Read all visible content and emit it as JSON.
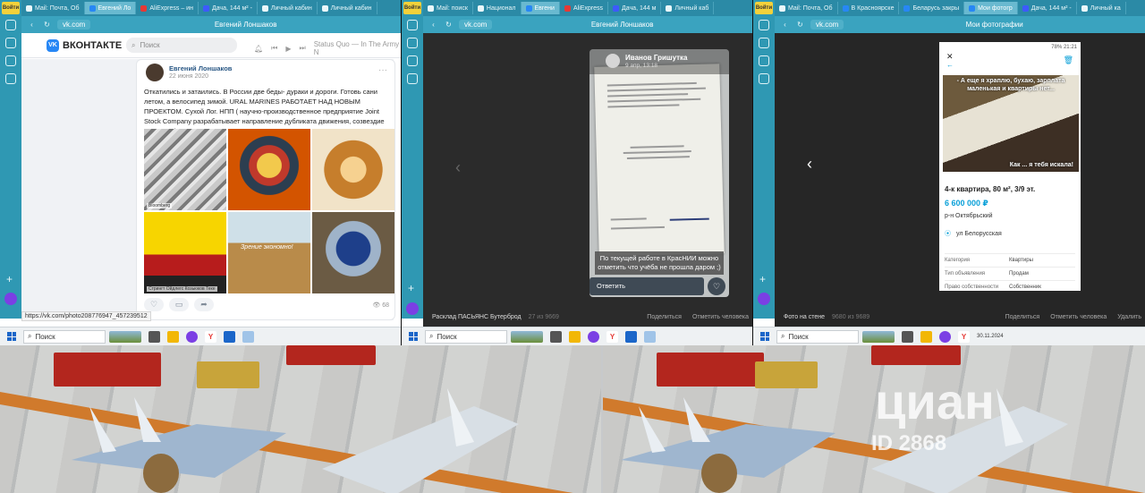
{
  "panel1": {
    "sidebar": {
      "badge": "Войти"
    },
    "tabs": [
      {
        "label": "Mail: Почта, Об",
        "active": false,
        "icon": "mail-icon"
      },
      {
        "label": "Евгений Ло",
        "active": true,
        "icon": "vk-icon"
      },
      {
        "label": "AliExpress – ин",
        "active": false,
        "icon": "aliexpress-icon"
      },
      {
        "label": "Дача, 144 м² -",
        "active": false,
        "icon": "domclick-icon"
      },
      {
        "label": "Личный кабин",
        "active": false,
        "icon": "cabinet-icon"
      },
      {
        "label": "Личный кабин",
        "active": false,
        "icon": "cabinet-icon"
      }
    ],
    "address": {
      "url": "vk.com",
      "title": "Евгений Лоншаков"
    },
    "vk": {
      "logo": "ВКОНТАКТЕ",
      "search_placeholder": "Поиск",
      "track": "Status Quo — In The Army N"
    },
    "post": {
      "author": "Евгений Лоншаков",
      "date": "22 июня 2020",
      "text": "Откатились и затаились. В России две беды- дураки и дороги. Готовь сани летом, а велосипед зимой. URAL MARINES РАБОТАЕТ НАД НОВЫМ ПРОЕКТОМ. Сухой Лог. НПП ( научно-производственное предприятие Joint Stock Company разрабатывает направление дубликата движения, созвездие Водолеев)",
      "captions": {
        "c1": "Bloomberg",
        "c4": "Стрингт Ойдлегс Козьюков Теке",
        "c5": "Зрение экономно!"
      },
      "views": "68"
    },
    "status_url": "https://vk.com/photo208776947_457239512",
    "taskbar": {
      "search": "Поиск"
    }
  },
  "panel2": {
    "tabs": [
      {
        "label": "Mail: поиск",
        "active": false,
        "icon": "mail-icon"
      },
      {
        "label": "Национал",
        "active": false,
        "icon": "news-icon"
      },
      {
        "label": "Евгени",
        "active": true,
        "icon": "vk-icon"
      },
      {
        "label": "AliExpress",
        "active": false,
        "icon": "aliexpress-icon"
      },
      {
        "label": "Дача, 144 м",
        "active": false,
        "icon": "domclick-icon"
      },
      {
        "label": "Личный каб",
        "active": false,
        "icon": "cabinet-icon"
      }
    ],
    "address": {
      "url": "vk.com",
      "title": "Евгений Лоншаков"
    },
    "viewer": {
      "name": "Иванов Гришутка",
      "date": "9 апр, 13:18",
      "caption": "По текущей работе в КрасНИИ можно отметить что учёба не прошла даром ;)",
      "reply": "Ответить"
    },
    "bottom": {
      "album": "Расклад ПАСЬЯНС Бутерброд",
      "counter": "27 из 9669",
      "share": "Поделиться",
      "mark": "Отметить человека"
    },
    "taskbar": {
      "search": "Поиск"
    }
  },
  "panel3": {
    "tabs": [
      {
        "label": "Mail: Почта, Об",
        "active": false,
        "icon": "mail-icon"
      },
      {
        "label": "В Красноярске",
        "active": false,
        "icon": "vk-icon"
      },
      {
        "label": "Беларусь закры",
        "active": false,
        "icon": "vk-icon"
      },
      {
        "label": "Мои фотогр",
        "active": true,
        "icon": "vk-icon"
      },
      {
        "label": "Дача, 144 м² -",
        "active": false,
        "icon": "domclick-icon"
      },
      {
        "label": "Личный ка",
        "active": false,
        "icon": "cabinet-icon"
      }
    ],
    "address": {
      "url": "vk.com",
      "title": "Мои фотографии"
    },
    "ad": {
      "phone_status": "78% 21:21",
      "meme_top": "- А еще я храплю, бухаю, зарплата маленькая и квартиры нет...",
      "meme_bottom": "Как ... я тебя искала!",
      "title": "4-к квартира, 80 м², 3/9 эт.",
      "price": "6 600 000 ₽",
      "district": "р-н Октябрьский",
      "address": "ул Белорусская",
      "rows": [
        {
          "k": "Категория",
          "v": "Квартиры"
        },
        {
          "k": "Тип объявления",
          "v": "Продам"
        },
        {
          "k": "Право собственности",
          "v": "Собственник"
        }
      ]
    },
    "bottom": {
      "album": "Фото на стене",
      "counter": "9680 из 9689",
      "share": "Поделиться",
      "mark": "Отметить человека",
      "delete": "Удалить"
    },
    "taskbar": {
      "search": "Поиск",
      "date": "30.11.2024"
    }
  },
  "photos": {
    "watermark": "циан",
    "watermark_id": "ID 2868"
  }
}
